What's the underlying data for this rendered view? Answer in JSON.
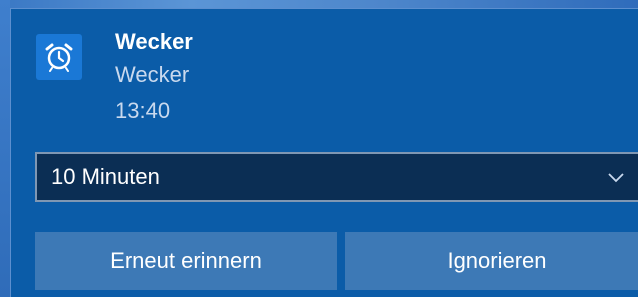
{
  "notification": {
    "app_icon": "alarm-clock-icon",
    "title": "Wecker",
    "subtitle": "Wecker",
    "time": "13:40",
    "snooze_select": {
      "selected": "10 Minuten",
      "icon": "chevron-down-icon"
    },
    "buttons": {
      "snooze": "Erneut erinnern",
      "dismiss": "Ignorieren"
    }
  },
  "colors": {
    "toast_bg": "#0b5ca8",
    "icon_bg": "#1a78d6",
    "select_bg": "#0b2e54",
    "button_bg": "#3d79b6",
    "text_secondary": "#c9d9ee"
  }
}
